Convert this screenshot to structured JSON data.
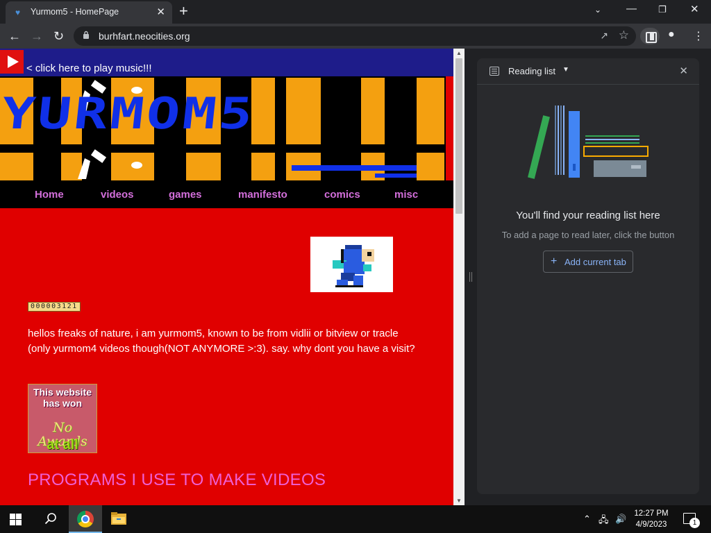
{
  "browser": {
    "tab_title": "Yurmom5 - HomePage",
    "url": "burhfart.neocities.org",
    "window_controls": [
      "minimize-icon",
      "restore-icon",
      "close-icon"
    ]
  },
  "page": {
    "music_link": "< click here to play music!!!",
    "banner_text": "YURMOM5",
    "nav": [
      "Home",
      "videos",
      "games",
      "manifesto",
      "comics",
      "misc"
    ],
    "counter": "000003121",
    "intro": "hellos freaks of nature, i am yurmom5, known to be from vidlii or bitview or tracle (only yurmom4 videos though(NOT ANYMORE >:3). say. why dont you have a visit?",
    "award": {
      "line1": "This website",
      "line2": "has won",
      "line3": "No",
      "line4": "Awards",
      "line5": "at all"
    },
    "programs_heading": "PROGRAMS I USE TO MAKE VIDEOS",
    "colors": {
      "background": "#e00000",
      "nav_link": "#d36fdb",
      "heading": "#ef60d6",
      "music_bar": "#1e1c8a"
    }
  },
  "reading_list": {
    "title": "Reading list",
    "empty_title": "You'll find your reading list here",
    "empty_subtitle": "To add a page to read later, click the button",
    "add_button": "Add current tab"
  },
  "taskbar": {
    "time": "12:27 PM",
    "date": "4/9/2023",
    "notification_count": "1"
  }
}
